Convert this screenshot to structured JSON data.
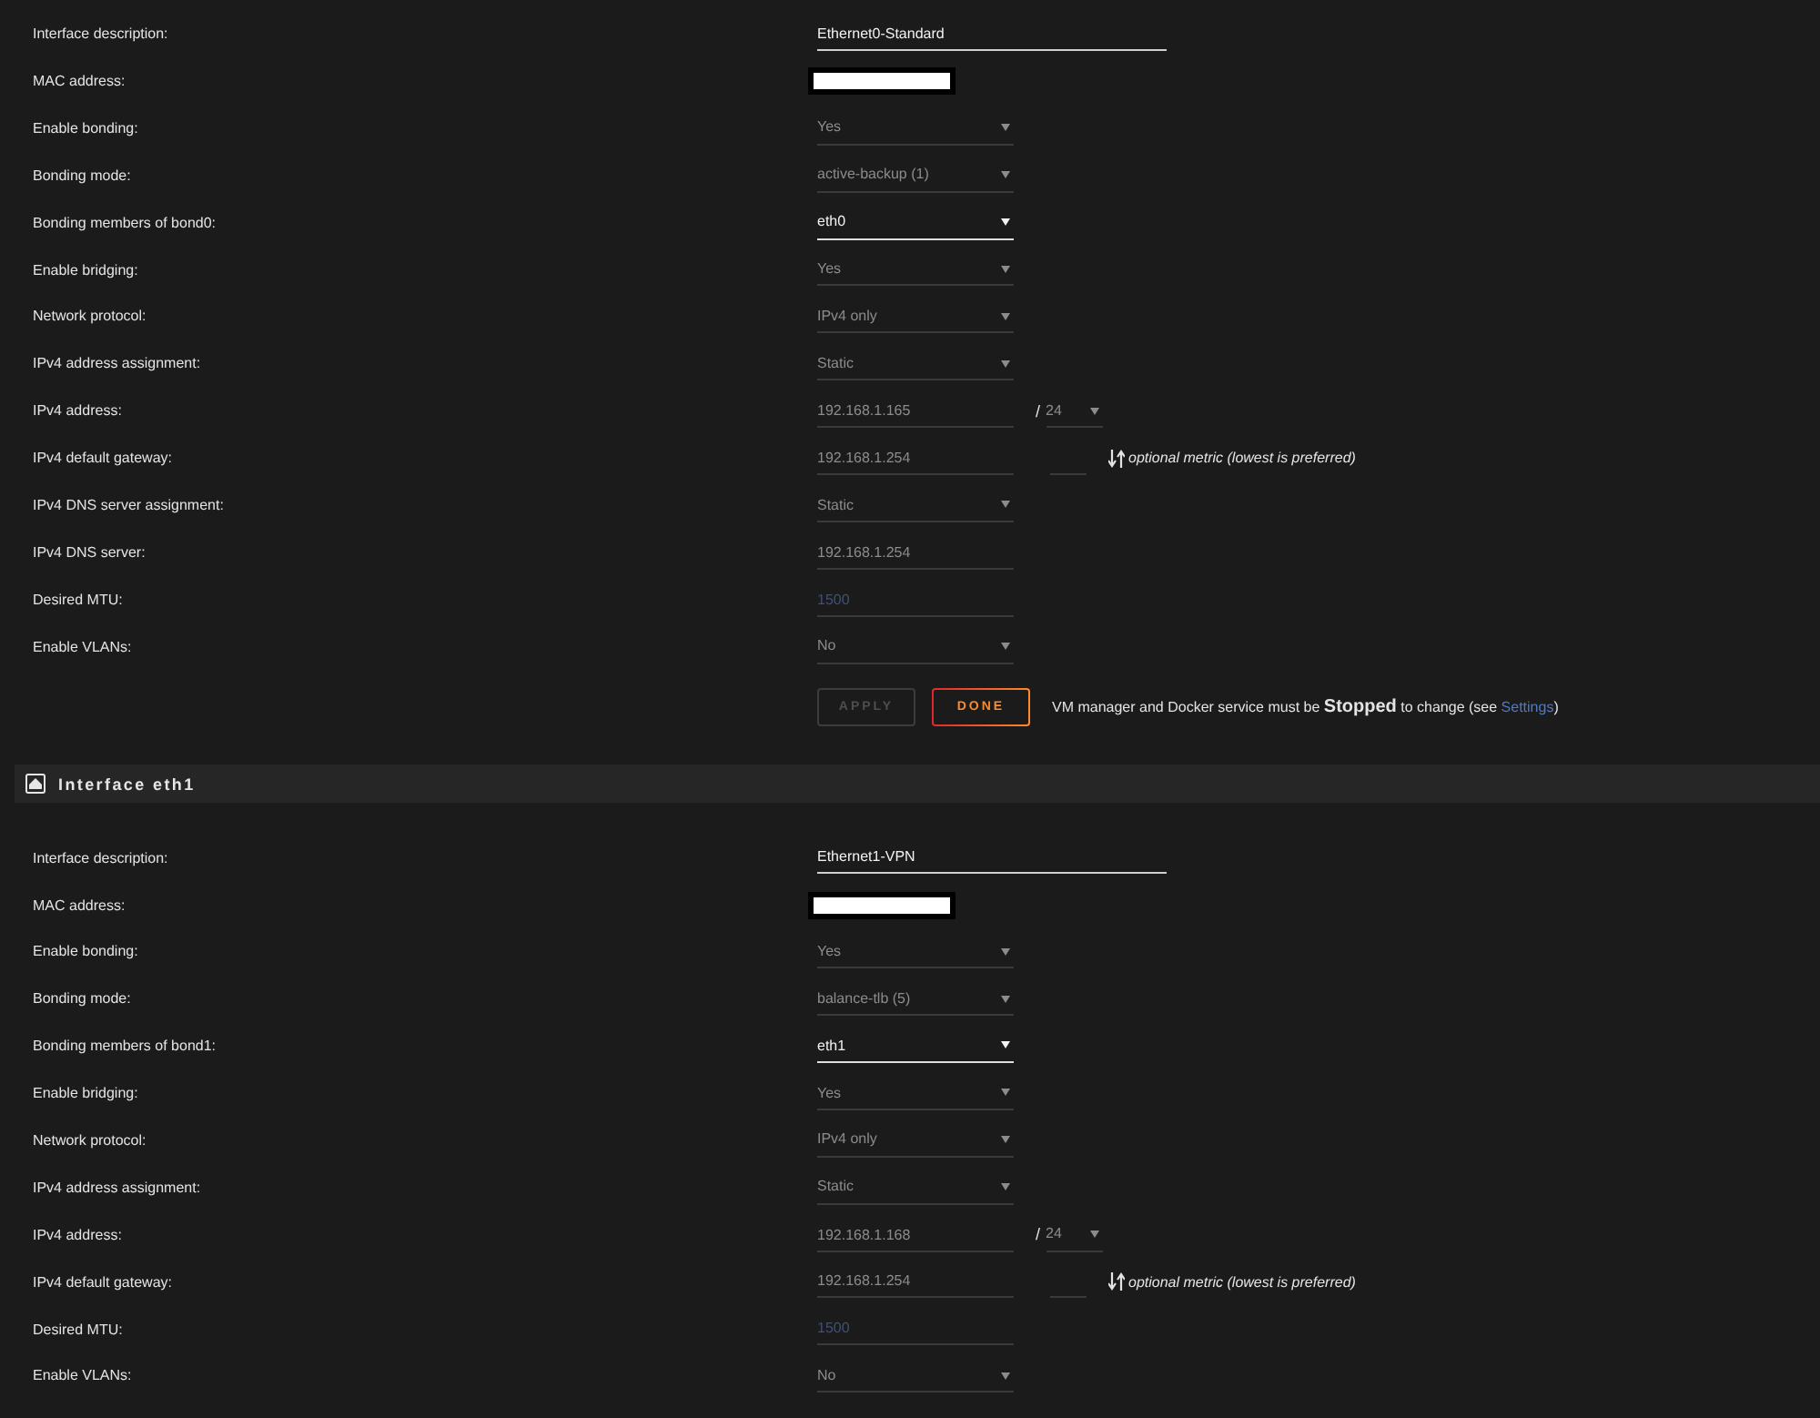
{
  "interfaces": [
    {
      "fields": [
        {
          "label": "Interface description:",
          "kind": "text",
          "value": "Ethernet0-Standard",
          "disabled": false
        },
        {
          "label": "MAC address:",
          "kind": "redacted"
        },
        {
          "label": "Enable bonding:",
          "kind": "select",
          "value": "Yes",
          "disabled": true
        },
        {
          "label": "Bonding mode:",
          "kind": "select",
          "value": "active-backup (1)",
          "disabled": true
        },
        {
          "label": "Bonding members of bond0:",
          "kind": "select",
          "value": "eth0",
          "disabled": false
        },
        {
          "label": "Enable bridging:",
          "kind": "select",
          "value": "Yes",
          "disabled": true
        },
        {
          "label": "Network protocol:",
          "kind": "select",
          "value": "IPv4 only",
          "disabled": true
        },
        {
          "label": "IPv4 address assignment:",
          "kind": "select",
          "value": "Static",
          "disabled": true
        },
        {
          "label": "IPv4 address:",
          "kind": "ip",
          "value": "192.168.1.165",
          "separator": "/",
          "prefix": "24",
          "disabled": true
        },
        {
          "label": "IPv4 default gateway:",
          "kind": "gateway",
          "value": "192.168.1.254",
          "hint": "optional metric (lowest is preferred)",
          "disabled": true
        },
        {
          "label": "IPv4 DNS server assignment:",
          "kind": "select",
          "value": "Static",
          "disabled": true
        },
        {
          "label": "IPv4 DNS server:",
          "kind": "text",
          "value": "192.168.1.254",
          "disabled": true
        },
        {
          "label": "Desired MTU:",
          "kind": "text",
          "placeholder": "1500",
          "disabled": true
        },
        {
          "label": "Enable VLANs:",
          "kind": "select",
          "value": "No",
          "disabled": true
        }
      ],
      "buttons": [
        {
          "label": "APPLY",
          "disabled": true
        },
        {
          "label": "DONE",
          "disabled": false
        }
      ],
      "note": {
        "before": "VM manager and Docker service must be **Stopped** to change (see ",
        "link": "Settings",
        "after": ")"
      }
    },
    {
      "title": "Interface eth1",
      "fields": [
        {
          "label": "Interface description:",
          "kind": "text",
          "value": "Ethernet1-VPN",
          "disabled": false
        },
        {
          "label": "MAC address:",
          "kind": "redacted"
        },
        {
          "label": "Enable bonding:",
          "kind": "select",
          "value": "Yes",
          "disabled": true
        },
        {
          "label": "Bonding mode:",
          "kind": "select",
          "value": "balance-tlb (5)",
          "disabled": true
        },
        {
          "label": "Bonding members of bond1:",
          "kind": "select",
          "value": "eth1",
          "disabled": false
        },
        {
          "label": "Enable bridging:",
          "kind": "select",
          "value": "Yes",
          "disabled": true
        },
        {
          "label": "Network protocol:",
          "kind": "select",
          "value": "IPv4 only",
          "disabled": true
        },
        {
          "label": "IPv4 address assignment:",
          "kind": "select",
          "value": "Static",
          "disabled": true
        },
        {
          "label": "IPv4 address:",
          "kind": "ip",
          "value": "192.168.1.168",
          "separator": "/",
          "prefix": "24",
          "disabled": true
        },
        {
          "label": "IPv4 default gateway:",
          "kind": "gateway",
          "value": "192.168.1.254",
          "hint": "optional metric (lowest is preferred)",
          "disabled": true
        },
        {
          "label": "Desired MTU:",
          "kind": "text",
          "placeholder": "1500",
          "disabled": true
        },
        {
          "label": "Enable VLANs:",
          "kind": "select",
          "value": "No",
          "disabled": true
        }
      ]
    }
  ]
}
